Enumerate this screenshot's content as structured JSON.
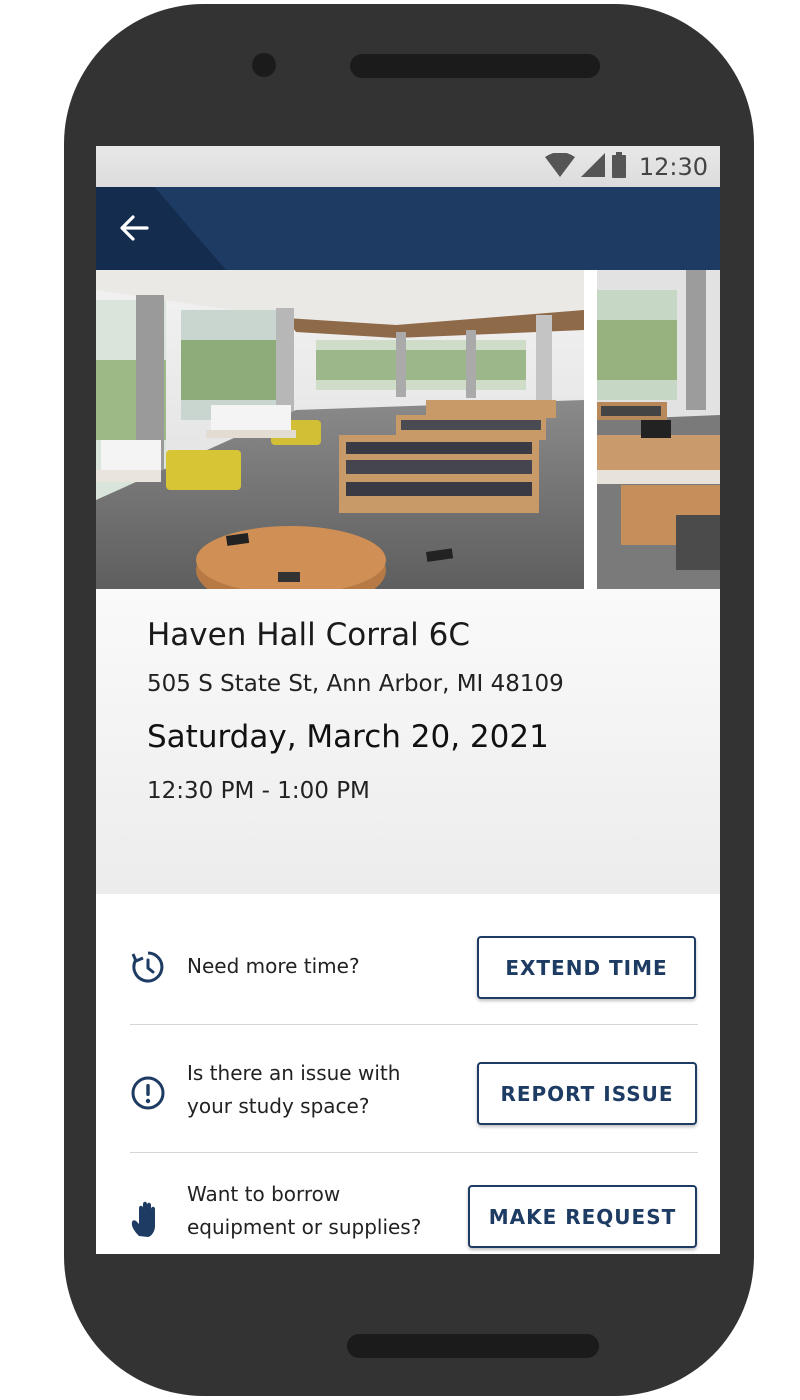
{
  "status_bar": {
    "time": "12:30",
    "icons": [
      "wifi-icon",
      "cell-signal-icon",
      "battery-icon"
    ]
  },
  "app_bar": {
    "back_icon": "arrow-left-icon",
    "color": "#1d3b63"
  },
  "hero": {
    "description_icon": "library-photo"
  },
  "space": {
    "name": "Haven Hall Corral 6C",
    "address": "505 S State St, Ann Arbor, MI 48109",
    "date": "Saturday, March 20, 2021",
    "time": "12:30 PM - 1:00 PM"
  },
  "actions": [
    {
      "icon": "clock-extend-icon",
      "prompt_lines": [
        "Need more time?"
      ],
      "button_label": "EXTEND TIME"
    },
    {
      "icon": "alert-circle-icon",
      "prompt_lines": [
        "Is there an issue with",
        "your study space?"
      ],
      "button_label": "REPORT ISSUE"
    },
    {
      "icon": "hand-icon",
      "prompt_lines": [
        "Want to borrow",
        "equipment or supplies?"
      ],
      "button_label": "MAKE REQUEST"
    }
  ],
  "colors": {
    "primary": "#1d3b63",
    "phone_frame": "#333333"
  }
}
